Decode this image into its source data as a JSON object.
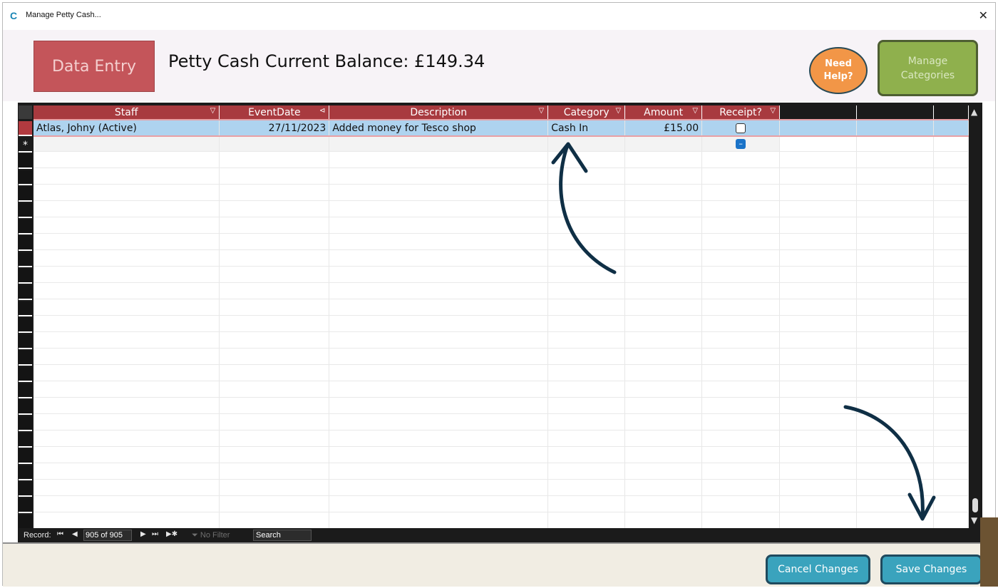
{
  "window": {
    "title": "Manage Petty Cash...",
    "app_icon": "C",
    "close_symbol": "✕"
  },
  "header": {
    "data_entry_label": "Data Entry",
    "balance_label": "Petty Cash Current Balance: £149.34",
    "help_label_line1": "Need",
    "help_label_line2": "Help?",
    "manage_label_line1": "Manage",
    "manage_label_line2": "Categories"
  },
  "grid": {
    "columns": [
      {
        "label": "Staff",
        "arrow": "▽"
      },
      {
        "label": "EventDate",
        "arrow": "⊲"
      },
      {
        "label": "Description",
        "arrow": "▽"
      },
      {
        "label": "Category",
        "arrow": "▽"
      },
      {
        "label": "Amount",
        "arrow": "▽"
      },
      {
        "label": "Receipt?",
        "arrow": "▽"
      }
    ],
    "rows": [
      {
        "staff": "Atlas, Johny (Active)",
        "event_date": "27/11/2023",
        "description": "Added money for Tesco shop",
        "category": "Cash In",
        "amount": "£15.00",
        "receipt": false
      }
    ],
    "new_row_marker": "*"
  },
  "record_bar": {
    "label": "Record:",
    "position": "905 of 905",
    "filter_label": "No Filter",
    "search_label": "Search",
    "nav_first": "⏮",
    "nav_prev": "◀",
    "nav_next": "▶",
    "nav_last": "⏭",
    "nav_new": "▶✱"
  },
  "footer": {
    "cancel_label": "Cancel Changes",
    "save_label": "Save Changes"
  },
  "colors": {
    "header_red": "#a83a3f",
    "selected_row": "#aed3ef",
    "data_entry": "#c4555a",
    "help": "#f29647",
    "manage": "#8fb04d",
    "footer_btn": "#3aa3bd",
    "annotation_arrow": "#0f2f45"
  }
}
